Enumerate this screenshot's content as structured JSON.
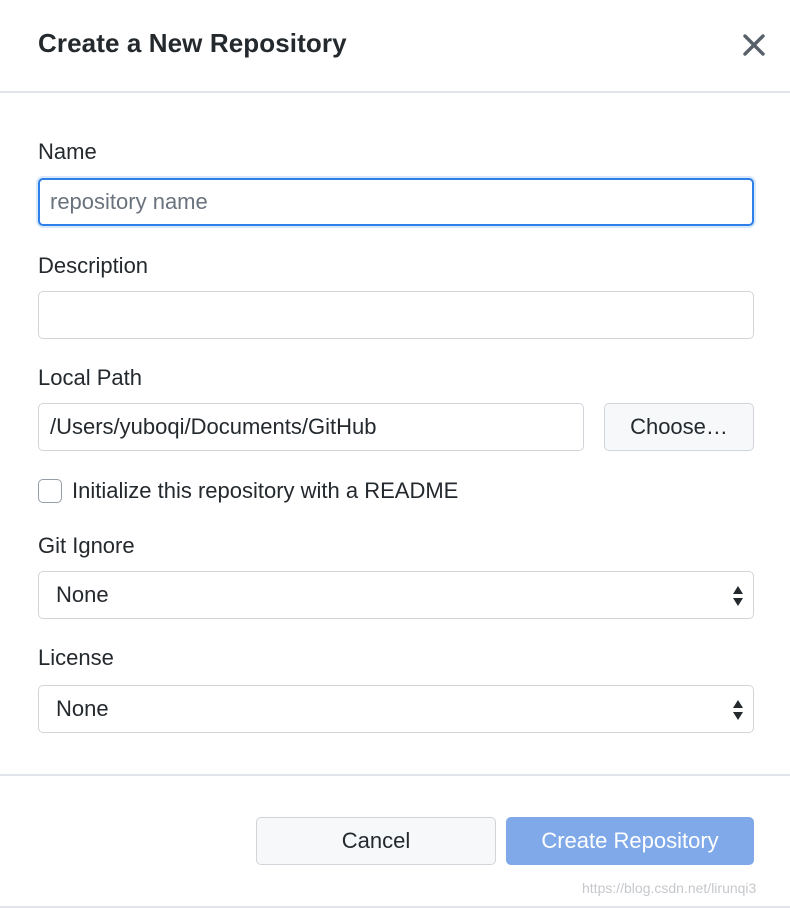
{
  "dialog": {
    "title": "Create a New Repository",
    "close_icon": "close-icon"
  },
  "form": {
    "name": {
      "label": "Name",
      "value": "",
      "placeholder": "repository name"
    },
    "description": {
      "label": "Description",
      "value": "",
      "placeholder": ""
    },
    "local_path": {
      "label": "Local Path",
      "value": "/Users/yuboqi/Documents/GitHub",
      "choose_label": "Choose…"
    },
    "readme": {
      "label": "Initialize this repository with a README",
      "checked": false
    },
    "git_ignore": {
      "label": "Git Ignore",
      "selected": "None"
    },
    "license": {
      "label": "License",
      "selected": "None"
    }
  },
  "footer": {
    "cancel_label": "Cancel",
    "create_label": "Create Repository"
  },
  "watermark": "https://blog.csdn.net/lirunqi3",
  "colors": {
    "focus_border": "#2f7fe8",
    "primary_button": "#7fa9e8",
    "text": "#24292e",
    "placeholder": "#6a737d"
  }
}
